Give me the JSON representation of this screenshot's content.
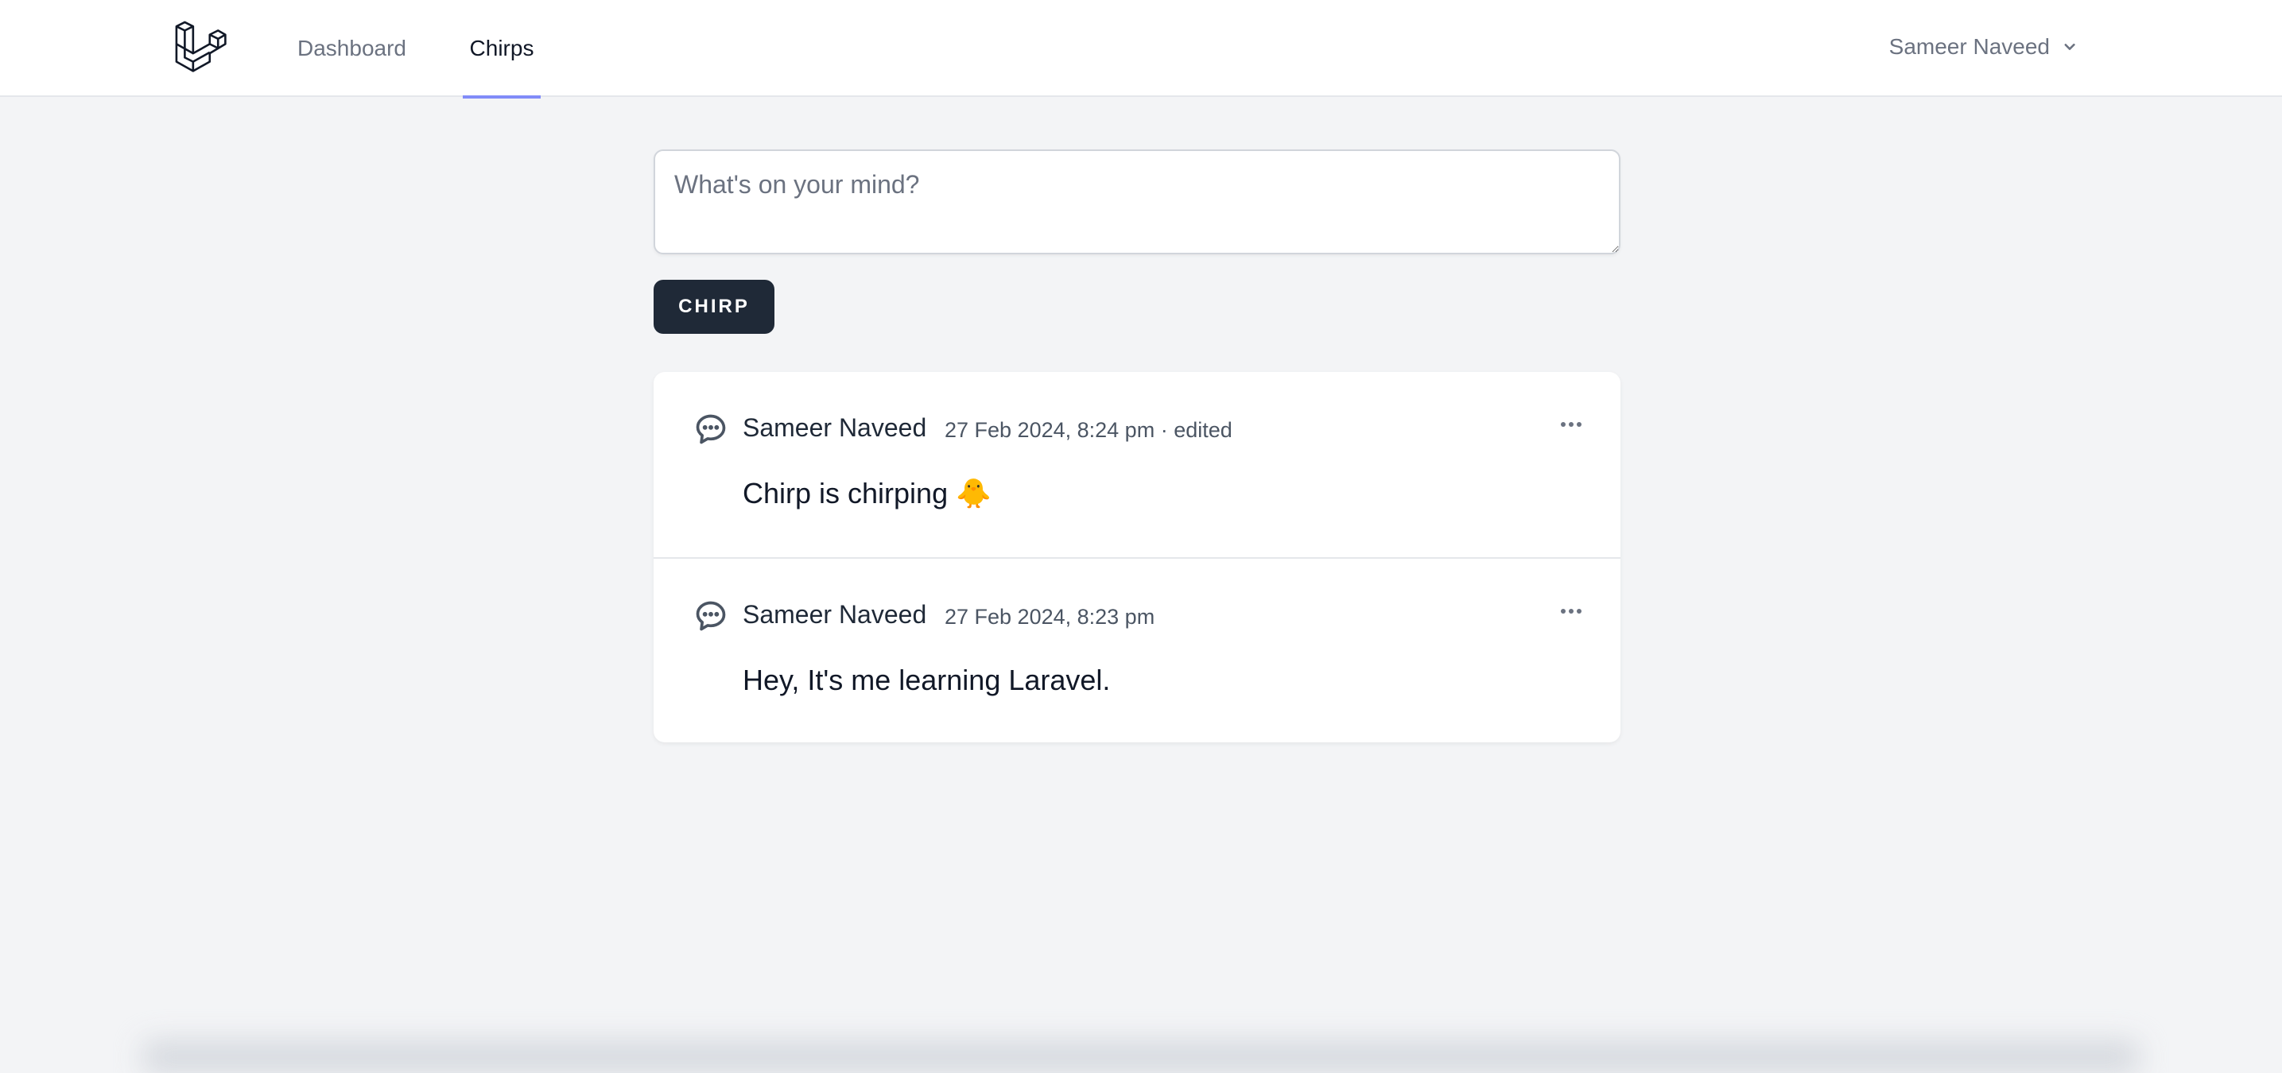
{
  "nav": {
    "links": [
      {
        "label": "Dashboard"
      },
      {
        "label": "Chirps"
      }
    ],
    "user_name": "Sameer Naveed"
  },
  "composer": {
    "placeholder": "What's on your mind?",
    "submit_label": "CHIRP"
  },
  "chirps": [
    {
      "author": "Sameer Naveed",
      "timestamp": "27 Feb 2024, 8:24 pm",
      "edited": "· edited",
      "message": "Chirp is chirping 🐥"
    },
    {
      "author": "Sameer Naveed",
      "timestamp": "27 Feb 2024, 8:23 pm",
      "edited": "",
      "message": "Hey, It's me learning Laravel."
    }
  ],
  "colors": {
    "accent": "#818cf8",
    "button": "#1f2937",
    "background": "#f3f4f6"
  },
  "icons": {
    "logo": "laravel-logo-icon",
    "user_menu": "chevron-down-icon",
    "chirp": "chat-bubble-icon",
    "actions": "ellipsis-icon"
  }
}
